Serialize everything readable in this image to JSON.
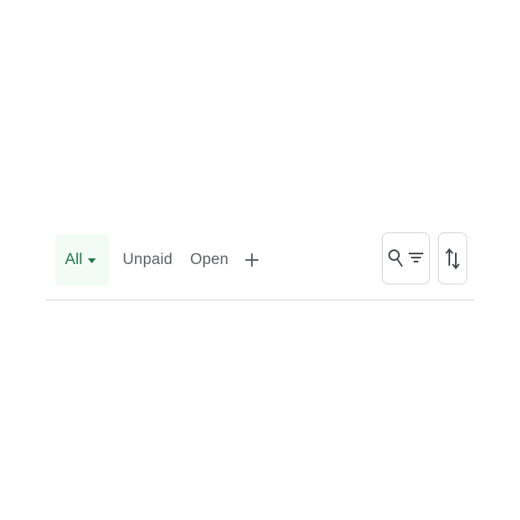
{
  "filter_tabs": {
    "items": [
      {
        "label": "All",
        "selected": true,
        "has_dropdown": true
      },
      {
        "label": "Unpaid",
        "selected": false
      },
      {
        "label": "Open",
        "selected": false
      }
    ],
    "add_view_icon": "plus-icon"
  },
  "actions": {
    "search_filter_icons": [
      "search-icon",
      "filter-icon"
    ],
    "sort_icon": "sort-arrows-icon"
  },
  "colors": {
    "accent": "#1f7a45",
    "selected_tab_bg": "#f3fbf6",
    "tab_text": "#5c6166",
    "divider": "#e6e8ea",
    "button_border": "#cfd3d7"
  }
}
